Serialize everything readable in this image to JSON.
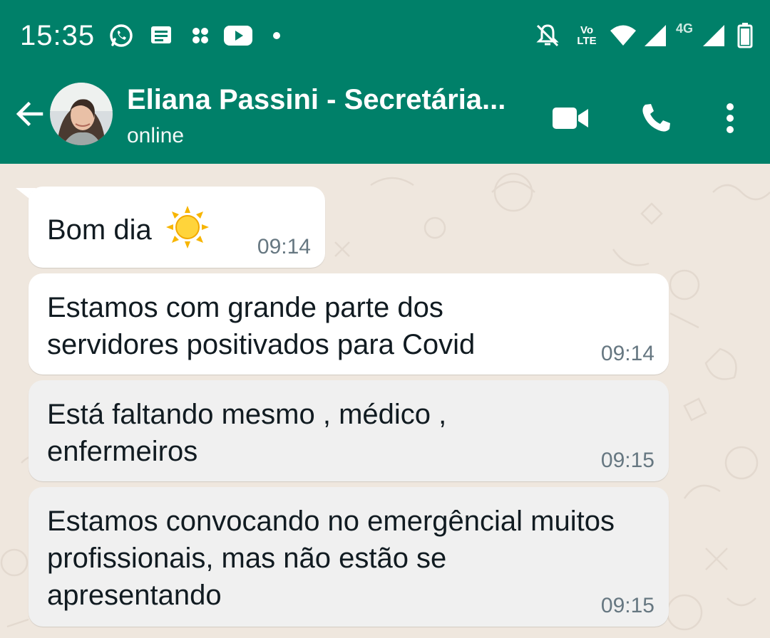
{
  "status_bar": {
    "time": "15:35",
    "left_icons": [
      "whatsapp-icon",
      "message-icon",
      "app-icon",
      "youtube-icon",
      "dot-icon"
    ],
    "right_icons": [
      "mute-icon",
      "volte-icon",
      "wifi-icon",
      "signal-icon",
      "signal-4g-icon",
      "battery-icon"
    ],
    "volte_label_top": "Vo",
    "volte_label_bottom": "LTE",
    "network_label": "4G"
  },
  "header": {
    "contact_name": "Eliana Passini - Secretária...",
    "contact_status": "online",
    "actions": [
      "video-call-icon",
      "voice-call-icon",
      "more-options-icon"
    ]
  },
  "messages": [
    {
      "text": "Bom dia",
      "emoji": "sun",
      "time": "09:14"
    },
    {
      "text": "Estamos com grande parte dos servidores positivados para Covid",
      "time": "09:14"
    },
    {
      "text": "Está faltando mesmo , médico , enfermeiros",
      "time": "09:15"
    },
    {
      "text": "Estamos convocando no emergêncial muitos profissionais, mas não estão se apresentando",
      "time": "09:15"
    }
  ],
  "colors": {
    "header": "#008069",
    "chat_background": "#efe7de",
    "bubble": "#ffffff",
    "timestamp": "#667781"
  }
}
